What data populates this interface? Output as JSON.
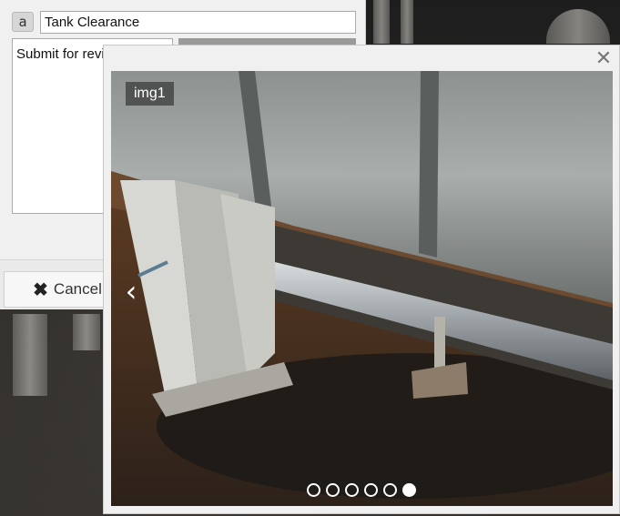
{
  "editor": {
    "type_icon": "a",
    "title_value": "Tank Clearance",
    "description_value": "Submit for review",
    "cancel_label": "Cancel"
  },
  "lightbox": {
    "image_label": "img1",
    "close_icon": "close-icon",
    "prev_icon": "chevron-left-icon",
    "slide_count": 6,
    "active_slide": 6
  },
  "colors": {
    "panel_bg": "#f0f0f0",
    "border": "#a9a9a9",
    "dot": "#ffffff"
  }
}
